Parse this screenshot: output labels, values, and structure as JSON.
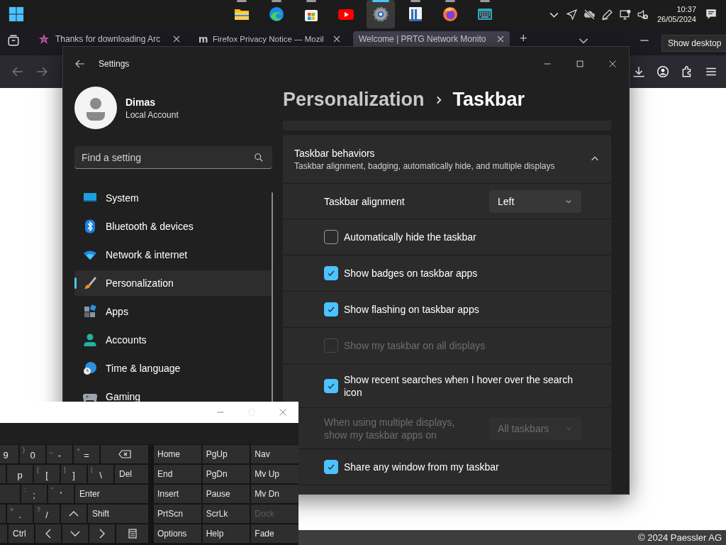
{
  "taskbar": {
    "apps": [
      {
        "kind": "folder",
        "running": true,
        "selected": false
      },
      {
        "kind": "edge",
        "running": true,
        "selected": false
      },
      {
        "kind": "store",
        "running": true,
        "selected": false
      },
      {
        "kind": "youtube",
        "running": false,
        "selected": false
      },
      {
        "kind": "settings",
        "running": true,
        "selected": true
      },
      {
        "kind": "book",
        "running": true,
        "selected": false
      },
      {
        "kind": "firefox",
        "running": true,
        "selected": false
      },
      {
        "kind": "keyboard",
        "running": true,
        "selected": false
      }
    ],
    "time": "10:37",
    "date": "26/05/2024"
  },
  "tooltip": "Show desktop",
  "browser": {
    "tabs": [
      {
        "title": "Thanks for downloading Arc",
        "selected": false
      },
      {
        "title": "Firefox Privacy Notice — Mozil",
        "favicon_text": "m",
        "selected": false
      },
      {
        "title": "Welcome | PRTG Network Monito",
        "selected": true
      }
    ],
    "new_tab": "+",
    "footer": "© 2024 Paessler AG"
  },
  "settings": {
    "title": "Settings",
    "user": {
      "name": "Dimas",
      "account": "Local Account"
    },
    "search": {
      "placeholder": "Find a setting"
    },
    "nav": [
      {
        "label": "System",
        "kind": "system",
        "selected": false
      },
      {
        "label": "Bluetooth & devices",
        "kind": "bluetooth",
        "selected": false
      },
      {
        "label": "Network & internet",
        "kind": "network",
        "selected": false
      },
      {
        "label": "Personalization",
        "kind": "personalization",
        "selected": true
      },
      {
        "label": "Apps",
        "kind": "apps",
        "selected": false
      },
      {
        "label": "Accounts",
        "kind": "accounts",
        "selected": false
      },
      {
        "label": "Time & language",
        "kind": "time",
        "selected": false
      },
      {
        "label": "Gaming",
        "kind": "gaming",
        "selected": false
      }
    ],
    "breadcrumb": {
      "parent": "Personalization",
      "current": "Taskbar"
    },
    "section": {
      "title": "Taskbar behaviors",
      "subtitle": "Taskbar alignment, badging, automatically hide, and multiple displays",
      "expanded": true,
      "rows": [
        {
          "kind": "dropdown",
          "label": "Taskbar alignment",
          "value": "Left",
          "disabled": false
        },
        {
          "kind": "checkbox",
          "label": "Automatically hide the taskbar",
          "checked": false,
          "disabled": false
        },
        {
          "kind": "checkbox",
          "label": "Show badges on taskbar apps",
          "checked": true,
          "disabled": false
        },
        {
          "kind": "checkbox",
          "label": "Show flashing on taskbar apps",
          "checked": true,
          "disabled": false
        },
        {
          "kind": "checkbox",
          "label": "Show my taskbar on all displays",
          "checked": false,
          "disabled": true
        },
        {
          "kind": "checkbox",
          "label": "Show recent searches when I hover over the search icon",
          "checked": true,
          "disabled": false
        },
        {
          "kind": "dropdown",
          "label": "When using multiple displays, show my taskbar apps on",
          "value": "All taskbars",
          "disabled": true
        },
        {
          "kind": "checkbox",
          "label": "Share any window from my taskbar",
          "checked": true,
          "disabled": false
        }
      ]
    }
  },
  "keyboard": {
    "rows": [
      [
        {
          "kind": "char",
          "main": "9"
        },
        {
          "kind": "char",
          "main": "0",
          "shift": ")"
        },
        {
          "kind": "char",
          "main": "-",
          "shift": "_"
        },
        {
          "kind": "char",
          "main": "=",
          "shift": "+"
        },
        {
          "kind": "backspace"
        }
      ],
      [
        {
          "kind": "blank"
        },
        {
          "kind": "char",
          "main": "p"
        },
        {
          "kind": "char",
          "main": "[",
          "shift": "{"
        },
        {
          "kind": "char",
          "main": "]",
          "shift": "}"
        },
        {
          "kind": "char",
          "main": "\\",
          "shift": "|"
        },
        {
          "kind": "label",
          "main": "Del"
        }
      ],
      [
        {
          "kind": "blank"
        },
        {
          "kind": "char",
          "main": ";",
          "shift": ":"
        },
        {
          "kind": "char",
          "main": "'",
          "shift": "\""
        },
        {
          "kind": "label",
          "main": "Enter"
        }
      ],
      [
        {
          "kind": "blank"
        },
        {
          "kind": "char",
          "main": ".",
          "shift": ">"
        },
        {
          "kind": "char",
          "main": "/",
          "shift": "?"
        },
        {
          "kind": "up"
        },
        {
          "kind": "label",
          "main": "Shift"
        }
      ],
      [
        {
          "kind": "blank"
        },
        {
          "kind": "label",
          "main": "Ctrl"
        },
        {
          "kind": "left"
        },
        {
          "kind": "down"
        },
        {
          "kind": "right"
        },
        {
          "kind": "menu"
        }
      ]
    ],
    "nav_keys": [
      {
        "label": "Home",
        "disabled": false
      },
      {
        "label": "PgUp",
        "disabled": false
      },
      {
        "label": "Nav",
        "disabled": false
      },
      {
        "label": "End",
        "disabled": false
      },
      {
        "label": "PgDn",
        "disabled": false
      },
      {
        "label": "Mv Up",
        "disabled": false
      },
      {
        "label": "Insert",
        "disabled": false
      },
      {
        "label": "Pause",
        "disabled": false
      },
      {
        "label": "Mv Dn",
        "disabled": false
      },
      {
        "label": "PrtScn",
        "disabled": false
      },
      {
        "label": "ScrLk",
        "disabled": false
      },
      {
        "label": "Dock",
        "disabled": true
      },
      {
        "label": "Options",
        "disabled": false
      },
      {
        "label": "Help",
        "disabled": false
      },
      {
        "label": "Fade",
        "disabled": false
      }
    ]
  }
}
